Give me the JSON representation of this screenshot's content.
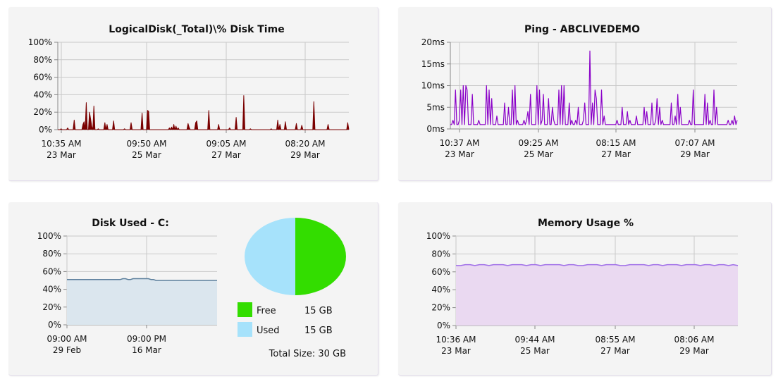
{
  "chart_data": [
    {
      "type": "area",
      "title": "LogicalDisk(_Total)\\% Disk Time",
      "y_ticks": [
        "100%",
        "80%",
        "60%",
        "40%",
        "20%",
        "0%"
      ],
      "ylim": [
        0,
        100
      ],
      "x_ticks": [
        {
          "time": "10:35 AM",
          "date": "23 Mar"
        },
        {
          "time": "09:50 AM",
          "date": "25 Mar"
        },
        {
          "time": "09:05 AM",
          "date": "27 Mar"
        },
        {
          "time": "08:20 AM",
          "date": "29 Mar"
        }
      ],
      "color": "#7a0000",
      "grid": true,
      "series": [
        {
          "values": [
            0,
            0,
            0,
            1,
            0,
            0,
            0,
            0,
            0,
            2,
            0,
            0,
            0,
            0,
            0,
            11,
            0,
            0,
            0,
            0,
            0,
            0,
            0,
            6,
            9,
            0,
            31,
            0,
            0,
            20,
            12,
            4,
            0,
            27,
            0,
            0,
            0,
            1,
            0,
            0,
            0,
            0,
            0,
            8,
            0,
            6,
            0,
            0,
            0,
            0,
            0,
            10,
            0,
            0,
            0,
            0,
            0,
            0,
            0,
            0,
            0,
            1,
            0,
            0,
            0,
            0,
            0,
            8,
            0,
            0,
            0,
            0,
            0,
            0,
            0,
            0,
            0,
            19,
            0,
            0,
            0,
            0,
            22,
            21,
            0,
            0,
            0,
            0,
            0,
            0,
            0,
            0,
            0,
            0,
            0,
            0,
            0,
            0,
            0,
            0,
            0,
            0,
            2,
            0,
            3,
            0,
            6,
            0,
            4,
            0,
            2,
            0,
            0,
            0,
            0,
            0,
            0,
            0,
            0,
            7,
            3,
            0,
            0,
            0,
            0,
            0,
            8,
            10,
            0,
            0,
            0,
            0,
            0,
            0,
            0,
            0,
            0,
            0,
            22,
            0,
            0,
            0,
            0,
            0,
            0,
            0,
            0,
            6,
            0,
            0,
            0,
            0,
            0,
            0,
            0,
            0,
            0,
            2,
            0,
            0,
            0,
            0,
            0,
            14,
            0,
            0,
            0,
            0,
            0,
            0,
            39,
            0,
            0,
            0,
            0,
            0,
            1,
            0,
            0,
            0,
            0,
            0,
            0,
            0,
            0,
            0,
            0,
            0,
            0,
            0,
            0,
            0,
            0,
            0,
            0,
            1,
            0,
            0,
            0,
            0,
            0,
            11,
            0,
            6,
            0,
            0,
            0,
            0,
            9,
            0,
            0,
            0,
            0,
            0,
            0,
            0,
            0,
            0,
            7,
            0,
            0,
            0,
            0,
            5,
            0,
            0,
            0,
            0,
            0,
            0,
            0,
            0,
            0,
            0,
            32,
            0,
            0,
            0,
            0,
            0,
            0,
            0,
            0,
            0,
            0,
            0,
            0,
            6,
            0,
            0,
            0,
            0,
            0,
            0,
            0,
            0,
            0,
            0,
            0,
            0,
            0,
            0,
            0,
            0,
            0,
            8,
            0
          ]
        }
      ]
    },
    {
      "type": "line",
      "title": "Ping - ABCLIVEDEMO",
      "y_ticks": [
        "20ms",
        "15ms",
        "10ms",
        "5ms",
        "0ms"
      ],
      "ylim": [
        0,
        20
      ],
      "x_ticks": [
        {
          "time": "10:37 AM",
          "date": "23 Mar"
        },
        {
          "time": "09:25 AM",
          "date": "25 Mar"
        },
        {
          "time": "08:15 AM",
          "date": "27 Mar"
        },
        {
          "time": "07:07 AM",
          "date": "29 Mar"
        }
      ],
      "color": "#8a00c8",
      "grid": true,
      "series": [
        {
          "values": [
            1,
            1,
            2,
            1,
            9,
            1,
            1,
            2,
            9,
            1,
            10,
            1,
            10,
            9,
            1,
            1,
            1,
            8,
            1,
            1,
            1,
            1,
            2,
            1,
            1,
            1,
            1,
            1,
            10,
            1,
            9,
            1,
            7,
            1,
            1,
            1,
            3,
            1,
            1,
            1,
            1,
            1,
            6,
            1,
            1,
            5,
            1,
            1,
            9,
            1,
            10,
            1,
            2,
            1,
            1,
            1,
            1,
            2,
            1,
            2,
            4,
            1,
            8,
            1,
            1,
            1,
            1,
            10,
            1,
            9,
            1,
            2,
            8,
            1,
            1,
            1,
            7,
            1,
            1,
            5,
            2,
            1,
            1,
            1,
            9,
            1,
            10,
            1,
            10,
            1,
            1,
            1,
            6,
            1,
            2,
            1,
            1,
            2,
            1,
            5,
            1,
            1,
            1,
            2,
            6,
            1,
            1,
            1,
            18,
            1,
            6,
            1,
            9,
            7,
            1,
            1,
            1,
            9,
            1,
            3,
            1,
            1,
            1,
            1,
            1,
            1,
            1,
            1,
            1,
            2,
            1,
            1,
            1,
            5,
            1,
            1,
            1,
            4,
            1,
            2,
            1,
            1,
            1,
            1,
            3,
            1,
            1,
            1,
            1,
            1,
            5,
            1,
            4,
            1,
            1,
            1,
            6,
            1,
            1,
            2,
            7,
            1,
            5,
            1,
            2,
            1,
            1,
            1,
            1,
            1,
            1,
            6,
            1,
            1,
            3,
            1,
            8,
            1,
            5,
            1,
            1,
            1,
            1,
            1,
            1,
            2,
            1,
            1,
            9,
            1,
            1,
            1,
            1,
            1,
            1,
            1,
            1,
            8,
            1,
            6,
            1,
            2,
            1,
            1,
            9,
            1,
            5,
            1,
            1,
            1,
            1,
            1,
            1,
            1,
            1,
            2,
            1,
            1,
            2,
            1,
            3,
            1,
            2
          ]
        }
      ]
    },
    {
      "type": "area",
      "title": "Disk Used - C:",
      "y_ticks": [
        "100%",
        "80%",
        "60%",
        "40%",
        "20%",
        "0%"
      ],
      "ylim": [
        0,
        100
      ],
      "x_ticks": [
        {
          "time": "09:00 AM",
          "date": "29 Feb"
        },
        {
          "time": "09:00 PM",
          "date": "16 Mar"
        }
      ],
      "color": "#5c7f9c",
      "fill": "#dbe6ee",
      "grid": true,
      "series": [
        {
          "values": [
            51,
            51,
            51,
            51,
            51,
            51,
            51,
            51,
            51,
            51,
            51,
            51,
            51,
            51,
            51,
            51,
            51,
            51,
            51,
            51,
            51,
            51,
            52,
            52,
            51,
            51,
            52,
            52,
            52,
            52,
            52,
            52,
            52,
            51,
            51,
            50,
            50,
            50,
            50,
            50,
            50,
            50,
            50,
            50,
            50,
            50,
            50,
            50,
            50,
            50,
            50,
            50,
            50,
            50,
            50,
            50,
            50,
            50,
            50,
            50
          ]
        }
      ]
    },
    {
      "type": "pie",
      "title": "",
      "slices": [
        {
          "label": "Free",
          "value": 15,
          "display": "15 GB",
          "color": "#33dd00"
        },
        {
          "label": "Used",
          "value": 15,
          "display": "15 GB",
          "color": "#a6e2fb"
        }
      ],
      "total_label": "Total Size: 30 GB"
    },
    {
      "type": "area",
      "title": "Memory Usage %",
      "y_ticks": [
        "100%",
        "80%",
        "60%",
        "40%",
        "20%",
        "0%"
      ],
      "ylim": [
        0,
        100
      ],
      "x_ticks": [
        {
          "time": "10:36 AM",
          "date": "23 Mar"
        },
        {
          "time": "09:44 AM",
          "date": "25 Mar"
        },
        {
          "time": "08:55 AM",
          "date": "27 Mar"
        },
        {
          "time": "08:06 AM",
          "date": "29 Mar"
        }
      ],
      "color": "#a070e8",
      "fill": "#ead9f1",
      "grid": true,
      "series": [
        {
          "values": [
            67,
            67,
            68,
            68,
            67,
            68,
            68,
            67,
            68,
            68,
            68,
            67,
            68,
            68,
            68,
            67,
            68,
            68,
            67,
            68,
            68,
            68,
            68,
            67,
            68,
            68,
            67,
            67,
            68,
            68,
            68,
            67,
            68,
            68,
            68,
            67,
            67,
            68,
            68,
            68,
            68,
            67,
            68,
            68,
            67,
            68,
            68,
            68,
            67,
            68,
            68,
            68,
            67,
            68,
            68,
            67,
            68,
            68,
            67,
            68,
            67
          ]
        }
      ]
    }
  ]
}
